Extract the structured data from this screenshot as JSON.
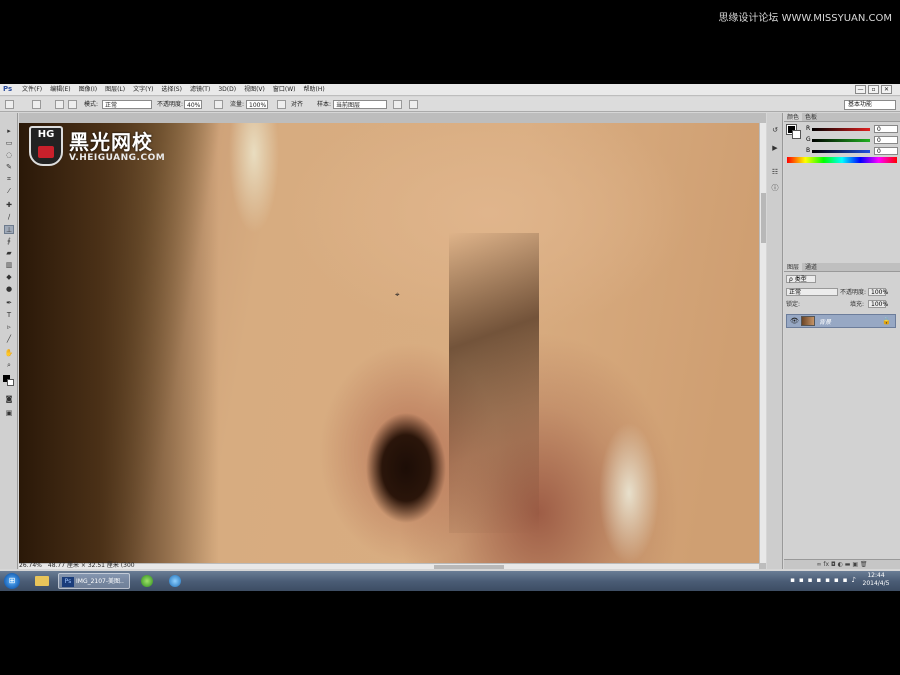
{
  "watermark_top": "思缘设计论坛 WWW.MISSYUAN.COM",
  "app": {
    "logo": "Ps"
  },
  "menu": [
    "文件(F)",
    "编辑(E)",
    "图像(I)",
    "图层(L)",
    "文字(Y)",
    "选择(S)",
    "滤镜(T)",
    "3D(D)",
    "视图(V)",
    "窗口(W)",
    "帮助(H)"
  ],
  "window_controls": [
    "—",
    "▫",
    "✕"
  ],
  "options": {
    "mode_label": "模式:",
    "mode_value": "正常",
    "opacity_label": "不透明度:",
    "opacity_value": "40%",
    "flow_label": "流量:",
    "flow_value": "100%",
    "aligned_label": "对齐",
    "sample_label": "样本:",
    "sample_value": "当前图层",
    "workspace": "基本功能"
  },
  "logo": {
    "shield_text": "HG",
    "cn_name": "黑光网校",
    "url": "V.HEIGUANG.COM"
  },
  "status": {
    "zoom": "26.74%",
    "doc_size": "48.77 厘米 × 32.51 厘米 (300"
  },
  "color_panel": {
    "tabs": [
      "颜色",
      "色板"
    ],
    "sliders": [
      {
        "label": "R",
        "value": "0",
        "color": "#e02020"
      },
      {
        "label": "G",
        "value": "0",
        "color": "#20b020"
      },
      {
        "label": "B",
        "value": "0",
        "color": "#2050e0"
      }
    ]
  },
  "layers_panel": {
    "tabs": [
      "图层",
      "通道"
    ],
    "kind_label": "ρ 类型",
    "blend_mode": "正常",
    "opacity_label": "不透明度:",
    "opacity_value": "100%",
    "lock_label": "锁定:",
    "fill_label": "填充:",
    "fill_value": "100%",
    "layer_name": "背景",
    "footer_icons": "∞  fx  ◘  ◐  ▬  ▣  🗑"
  },
  "taskbar": {
    "ps_task": "IMG_2107-美图..",
    "clock_time": "12:44",
    "clock_date": "2014/4/5"
  }
}
